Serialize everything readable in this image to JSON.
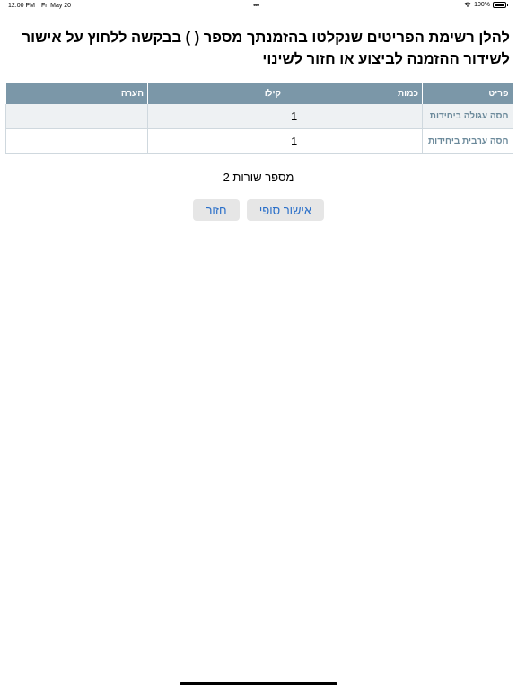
{
  "status_bar": {
    "time": "12:00 PM",
    "date": "Fri May 20",
    "dots": "•••",
    "battery_percent": "100%"
  },
  "title": "להלן רשימת הפריטים שנקלטו בהזמנתך מספר ( ) בבקשה ללחוץ על אישור לשידור ההזמנה לביצוע או חזור לשינוי",
  "table": {
    "columns": [
      "פריט",
      "כמות",
      "קילו",
      "הערה"
    ],
    "rows": [
      {
        "item": "חסה עגולה ביחידות",
        "quantity": "1",
        "kilo": "",
        "note": ""
      },
      {
        "item": "חסה ערבית ביחידות",
        "quantity": "1",
        "kilo": "",
        "note": ""
      }
    ]
  },
  "row_count_label": "מספר שורות 2",
  "buttons": {
    "confirm": "אישור סופי",
    "back": "חזור"
  },
  "colors": {
    "header_bg": "#7b97a8",
    "item_text": "#6c8a9b",
    "button_text": "#2a6fc9",
    "button_bg": "#e6e6e6"
  },
  "icons": [
    "wifi-icon",
    "battery-icon"
  ]
}
